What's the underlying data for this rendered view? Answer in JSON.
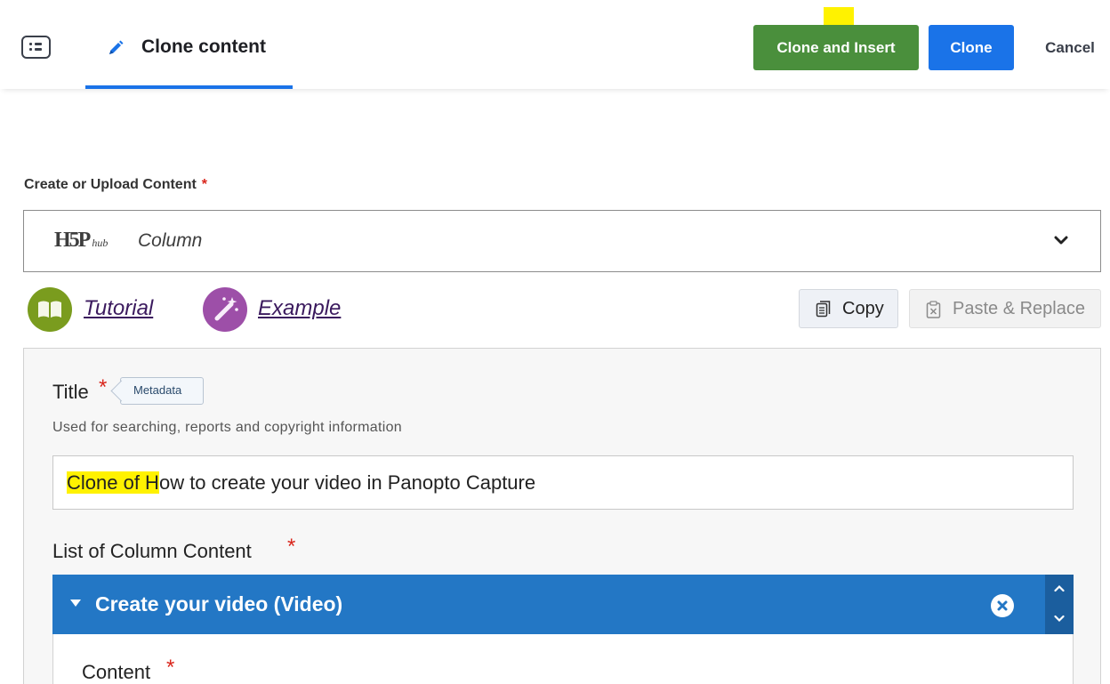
{
  "header": {
    "menu_icon": "list-menu-icon",
    "tab_icon": "pencil-icon",
    "tab_label": "Clone content",
    "clone_insert_label": "Clone and Insert",
    "clone_label": "Clone",
    "cancel_label": "Cancel",
    "accent_color": "#1a73e8",
    "insert_color": "#4a8f3c",
    "highlight_color": "#fff200"
  },
  "upload": {
    "label": "Create or Upload Content",
    "required_mark": "*",
    "hub_logo_text": "H5P",
    "hub_logo_sub": "hub",
    "selected_type": "Column"
  },
  "links": {
    "tutorial_label": "Tutorial",
    "tutorial_icon": "book-icon",
    "example_label": "Example",
    "example_icon": "magic-wand-icon"
  },
  "clipboard": {
    "copy_label": "Copy",
    "paste_label": "Paste & Replace"
  },
  "form": {
    "title_label": "Title",
    "required_mark": "*",
    "metadata_label": "Metadata",
    "title_description": "Used for searching, reports and copyright information",
    "title_value_highlighted": "Clone of H",
    "title_value_rest": "ow to create your video in Panopto Capture",
    "list_label": "List of Column Content",
    "group_title": "Create your video (Video)",
    "content_label": "Content"
  }
}
